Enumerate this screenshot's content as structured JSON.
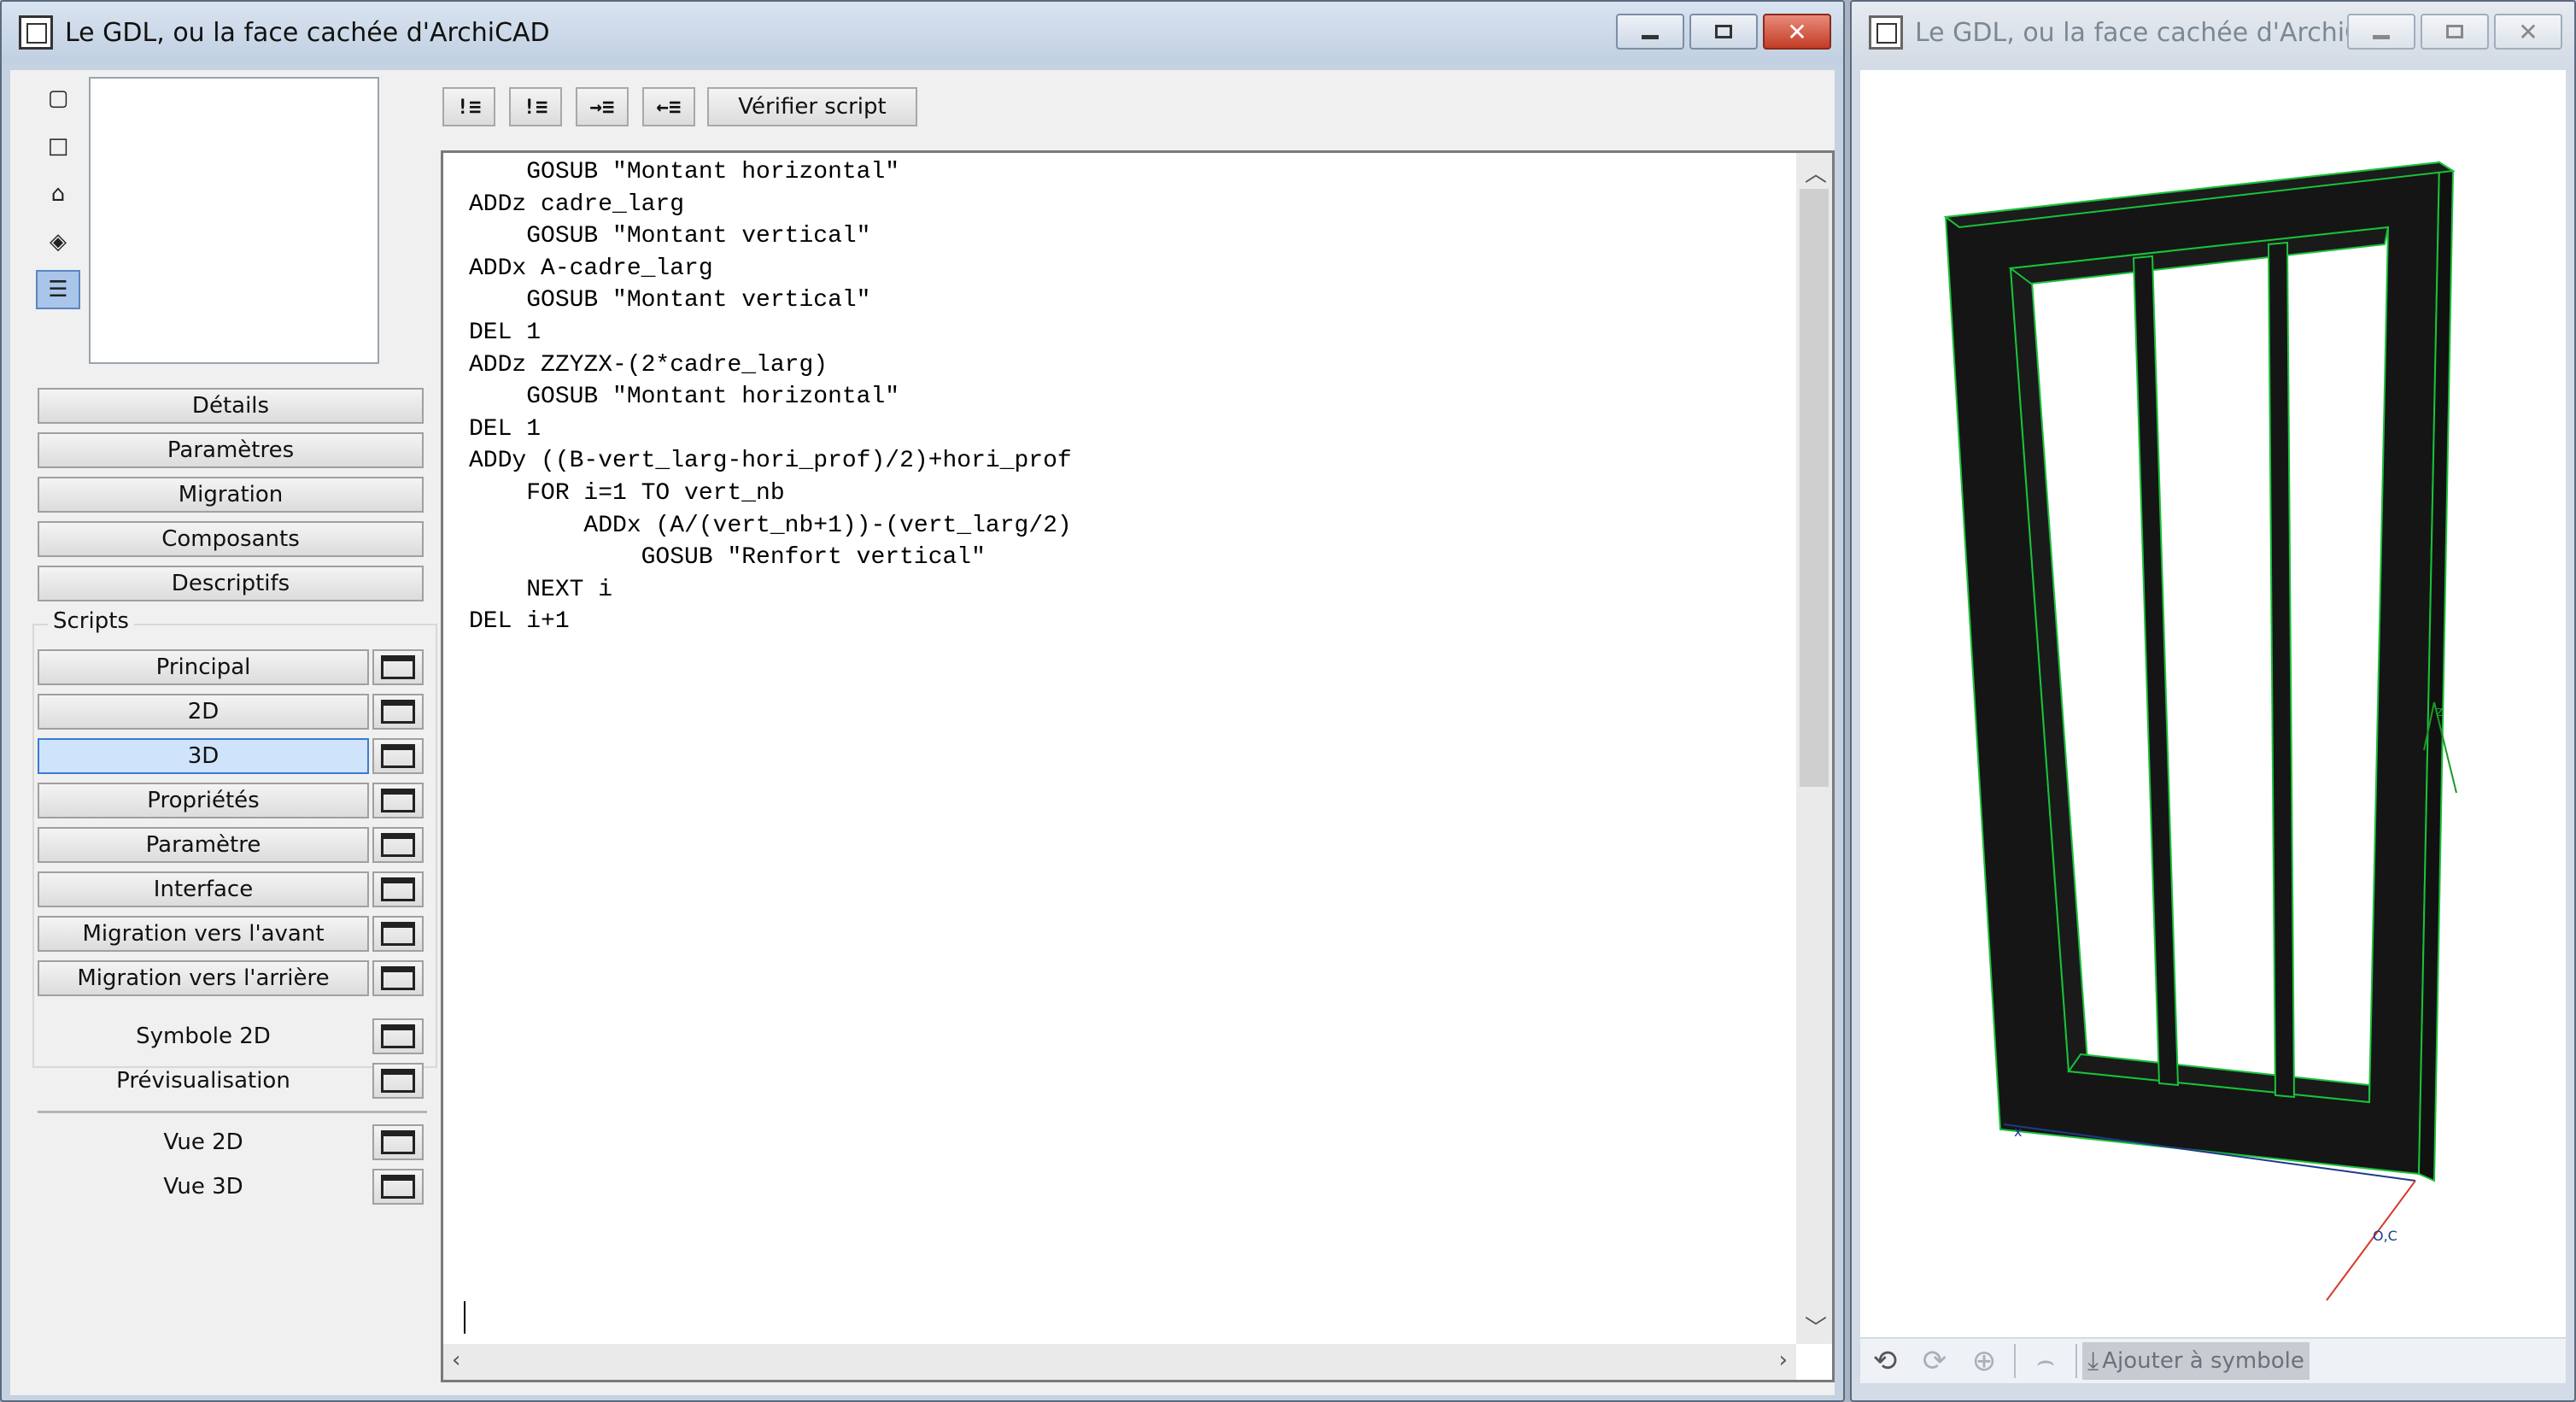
{
  "editor_window": {
    "title": "Le GDL, ou la face cachée d'ArchiCAD"
  },
  "view_window": {
    "title": "Le GDL, ou la face cachée d'ArchiC..."
  },
  "window_buttons": {
    "minimize": "–",
    "maximize": "□",
    "close": "✕"
  },
  "view_icons": [
    "square-small-icon",
    "square-icon",
    "object-icon",
    "cube-icon",
    "script-list-icon"
  ],
  "sidebar": {
    "sections": [
      "Détails",
      "Paramètres",
      "Migration",
      "Composants",
      "Descriptifs"
    ],
    "scripts_label": "Scripts",
    "scripts": [
      {
        "label": "Principal",
        "selected": false
      },
      {
        "label": "2D",
        "selected": false
      },
      {
        "label": "3D",
        "selected": true
      },
      {
        "label": "Propriétés",
        "selected": false
      },
      {
        "label": "Paramètre",
        "selected": false
      },
      {
        "label": "Interface",
        "selected": false
      },
      {
        "label": "Migration vers l'avant",
        "selected": false
      },
      {
        "label": "Migration vers l'arrière",
        "selected": false
      }
    ],
    "extras": [
      "Symbole 2D",
      "Prévisualisation"
    ],
    "views": [
      "Vue 2D",
      "Vue 3D"
    ]
  },
  "toolbar": {
    "icons": [
      "!≡",
      "!≡",
      "→≡",
      "←≡"
    ],
    "verify_label": "Vérifier script"
  },
  "code": {
    "lines": [
      "    GOSUB \"Montant horizontal\"",
      "ADDz cadre_larg",
      "    GOSUB \"Montant vertical\"",
      "ADDx A-cadre_larg",
      "    GOSUB \"Montant vertical\"",
      "DEL 1",
      "ADDz ZZYZX-(2*cadre_larg)",
      "    GOSUB \"Montant horizontal\"",
      "DEL 1",
      "ADDy ((B-vert_larg-hori_prof)/2)+hori_prof",
      "    FOR i=1 TO vert_nb",
      "        ADDx (A/(vert_nb+1))-(vert_larg/2)",
      "            GOSUB \"Renfort vertical\"",
      "    NEXT i",
      "DEL i+1"
    ]
  },
  "view3d": {
    "axis_labels": {
      "z": "z",
      "x": "x",
      "o": "O,C"
    },
    "colors": {
      "frame": "#151515",
      "edge": "#19c23a",
      "x_axis": "#1e3a8a",
      "y_axis": "#d63a2a",
      "z_axis": "#1a9a2a"
    },
    "bottom_toolbar": {
      "icons": [
        "rotate-left-icon",
        "rotate-right-icon",
        "zoom-icon",
        "undo-view-icon",
        "add-symbol-icon"
      ],
      "add_symbol_label": "Ajouter à symbole"
    }
  }
}
